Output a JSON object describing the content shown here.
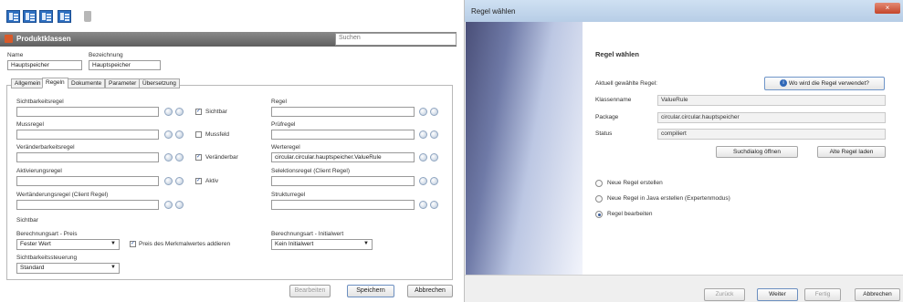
{
  "left": {
    "toolbar": {
      "icons": [
        "list-view-icon",
        "detail-view-icon",
        "split-view-icon",
        "table-view-icon",
        "trash-icon"
      ]
    },
    "panel_title": "Produktklassen",
    "search_value": "Suchen",
    "name_label": "Name",
    "name_value": "Hauptspeicher",
    "bezeichnung_label": "Bezeichnung",
    "bezeichnung_value": "Hauptspeicher",
    "tabs": [
      "Allgemein",
      "Regeln",
      "Dokumente",
      "Parameter",
      "Übersetzung"
    ],
    "left_column": {
      "sichtbarkeitsregel": "Sichtbarkeitsregel",
      "sichtbar_check": "Sichtbar",
      "mussregel": "Mussregel",
      "mussfeld_check": "Mussfeld",
      "veraenderbarkeitsregel": "Veränderbarkeitsregel",
      "veraenderbar_check": "Veränderbar",
      "aktivierungsregel": "Aktivierungsregel",
      "aktiv_check": "Aktiv",
      "wertaenderungsregel": "Wertänderungsregel (Client Regel)",
      "sichtbar_section": "Sichtbar",
      "berechnungsart_preis": "Berechnungsart - Preis",
      "preis_select": "Fester Wert",
      "preis_merkmal_check": "Preis des Merkmalwertes addieren",
      "sichtbarkeitssteuerung": "Sichtbarkeitssteuerung",
      "steuerung_select": "Standard"
    },
    "right_column": {
      "regel": "Regel",
      "pruefregel": "Prüfregel",
      "werteregel": "Werteregel",
      "werteregel_value": "circular.circular.hauptspeicher.ValueRule",
      "selektionsregel": "Selektionsregel (Client Regel)",
      "strukturregel": "Strukturregel",
      "berechnungsart_initialwert": "Berechnungsart - Initialwert",
      "initialwert_select": "Kein Initialwert"
    },
    "buttons": {
      "bearbeiten": "Bearbeiten",
      "speichern": "Speichern",
      "abbrechen": "Abbrechen"
    }
  },
  "right": {
    "window_title": "Regel wählen",
    "close_symbol": "×",
    "heading": "Regel wählen",
    "aktuell_label": "Aktuell gewählte Regel:",
    "wo_button": "Wo wird die Regel verwendet?",
    "klassenname_label": "Klassenname",
    "klassenname_value": "ValueRule",
    "package_label": "Package",
    "package_value": "circular.circular.hauptspeicher",
    "status_label": "Status",
    "status_value": "compiliert",
    "suchdialog_button": "Suchdialog öffnen",
    "alte_regel_button": "Alte Regel laden",
    "options": [
      "Neue Regel erstellen",
      "Neue Regel in Java erstellen (Expertenmodus)",
      "Regel bearbeiten"
    ],
    "selected_option": "Regel bearbeiten",
    "footer": {
      "zurueck": "Zurück",
      "weiter": "Weiter",
      "fertig": "Fertig",
      "abbrechen": "Abbrechen"
    }
  }
}
